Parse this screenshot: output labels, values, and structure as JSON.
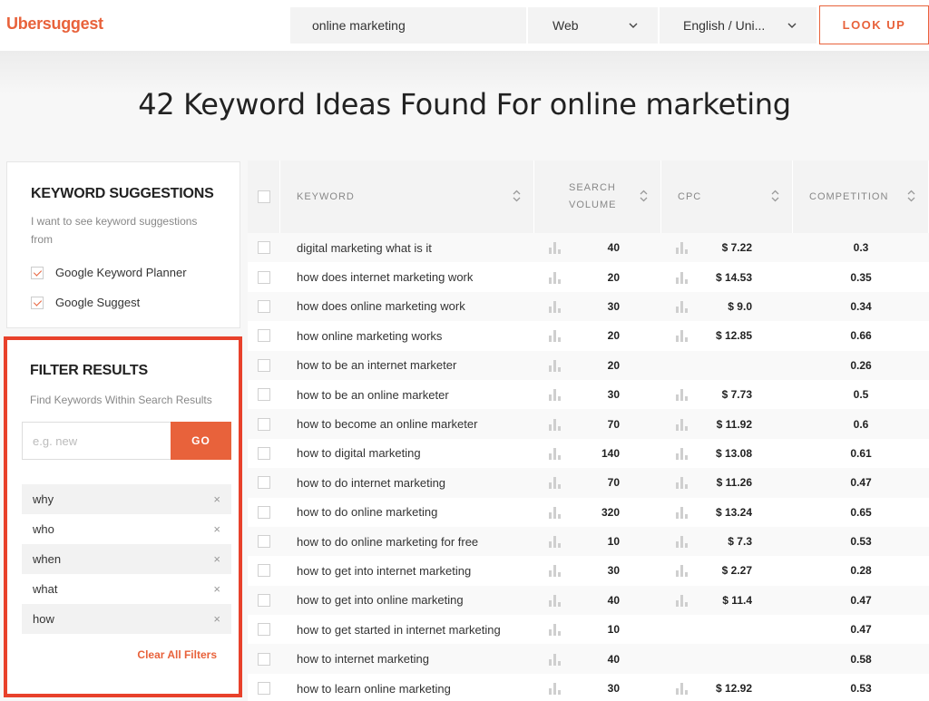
{
  "header": {
    "logo": "Ubersuggest",
    "search_value": "online marketing",
    "platform": "Web",
    "language": "English / Uni...",
    "lookup_label": "LOOK UP"
  },
  "page_title": "42 Keyword Ideas Found For online marketing",
  "suggestions": {
    "title": "KEYWORD SUGGESTIONS",
    "description": "I want to see keyword suggestions from",
    "options": [
      {
        "label": "Google Keyword Planner",
        "checked": true
      },
      {
        "label": "Google Suggest",
        "checked": true
      }
    ]
  },
  "filter": {
    "title": "FILTER RESULTS",
    "description": "Find Keywords Within Search Results",
    "placeholder": "e.g. new",
    "go_label": "GO",
    "tags": [
      "why",
      "who",
      "when",
      "what",
      "how"
    ],
    "remove_glyph": "×",
    "clear_label": "Clear All Filters"
  },
  "table": {
    "headers": {
      "keyword": "KEYWORD",
      "volume": "SEARCH VOLUME",
      "cpc": "CPC",
      "competition": "COMPETITION"
    },
    "rows": [
      {
        "keyword": "digital marketing what is it",
        "volume": "40",
        "cpc": "$ 7.22",
        "competition": "0.3"
      },
      {
        "keyword": "how does internet marketing work",
        "volume": "20",
        "cpc": "$ 14.53",
        "competition": "0.35"
      },
      {
        "keyword": "how does online marketing work",
        "volume": "30",
        "cpc": "$ 9.0",
        "competition": "0.34"
      },
      {
        "keyword": "how online marketing works",
        "volume": "20",
        "cpc": "$ 12.85",
        "competition": "0.66"
      },
      {
        "keyword": "how to be an internet marketer",
        "volume": "20",
        "cpc": "",
        "competition": "0.26"
      },
      {
        "keyword": "how to be an online marketer",
        "volume": "30",
        "cpc": "$ 7.73",
        "competition": "0.5"
      },
      {
        "keyword": "how to become an online marketer",
        "volume": "70",
        "cpc": "$ 11.92",
        "competition": "0.6"
      },
      {
        "keyword": "how to digital marketing",
        "volume": "140",
        "cpc": "$ 13.08",
        "competition": "0.61"
      },
      {
        "keyword": "how to do internet marketing",
        "volume": "70",
        "cpc": "$ 11.26",
        "competition": "0.47"
      },
      {
        "keyword": "how to do online marketing",
        "volume": "320",
        "cpc": "$ 13.24",
        "competition": "0.65"
      },
      {
        "keyword": "how to do online marketing for free",
        "volume": "10",
        "cpc": "$ 7.3",
        "competition": "0.53"
      },
      {
        "keyword": "how to get into internet marketing",
        "volume": "30",
        "cpc": "$ 2.27",
        "competition": "0.28"
      },
      {
        "keyword": "how to get into online marketing",
        "volume": "40",
        "cpc": "$ 11.4",
        "competition": "0.47"
      },
      {
        "keyword": "how to get started in internet marketing",
        "volume": "10",
        "cpc": "",
        "competition": "0.47"
      },
      {
        "keyword": "how to internet marketing",
        "volume": "40",
        "cpc": "",
        "competition": "0.58"
      },
      {
        "keyword": "how to learn online marketing",
        "volume": "30",
        "cpc": "$ 12.92",
        "competition": "0.53"
      }
    ]
  },
  "colors": {
    "accent": "#e8623b",
    "highlight_border": "#e8412b"
  },
  "icons": [
    "chevron-down-icon",
    "sort-icon",
    "bar-chart-icon",
    "checkmark-icon",
    "close-icon"
  ]
}
